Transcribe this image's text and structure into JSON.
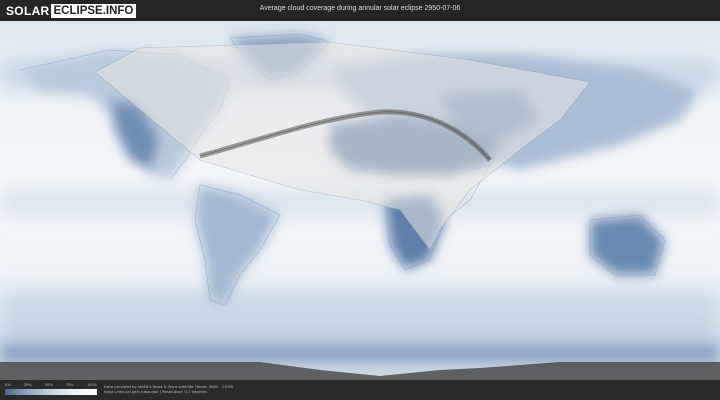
{
  "logo": {
    "part1": "SOLAR",
    "part2": "ECLIPSE.INFO"
  },
  "title": "Average cloud coverage during annular solar eclipse 2950-07-06",
  "legend": {
    "ticks": [
      "0%",
      "25%",
      "50%",
      "75%",
      "100%"
    ]
  },
  "credit": {
    "line1": "Data provided by NASA's Aqua & Terra satellite (Years: 2000 - 2019)",
    "line2": "https://neo.sci.gsfc.nasa.gov  |  Resolution: 0.1 degrees"
  },
  "colors": {
    "clear_sky": "#f4f8fb",
    "cloud_dark": "#5b7aa3",
    "cloud_mid": "#a9bfd8",
    "eclipse_path": "#6f6f6f",
    "bar_background": "#252525"
  },
  "icons": [
    "world-map",
    "eclipse-path"
  ]
}
